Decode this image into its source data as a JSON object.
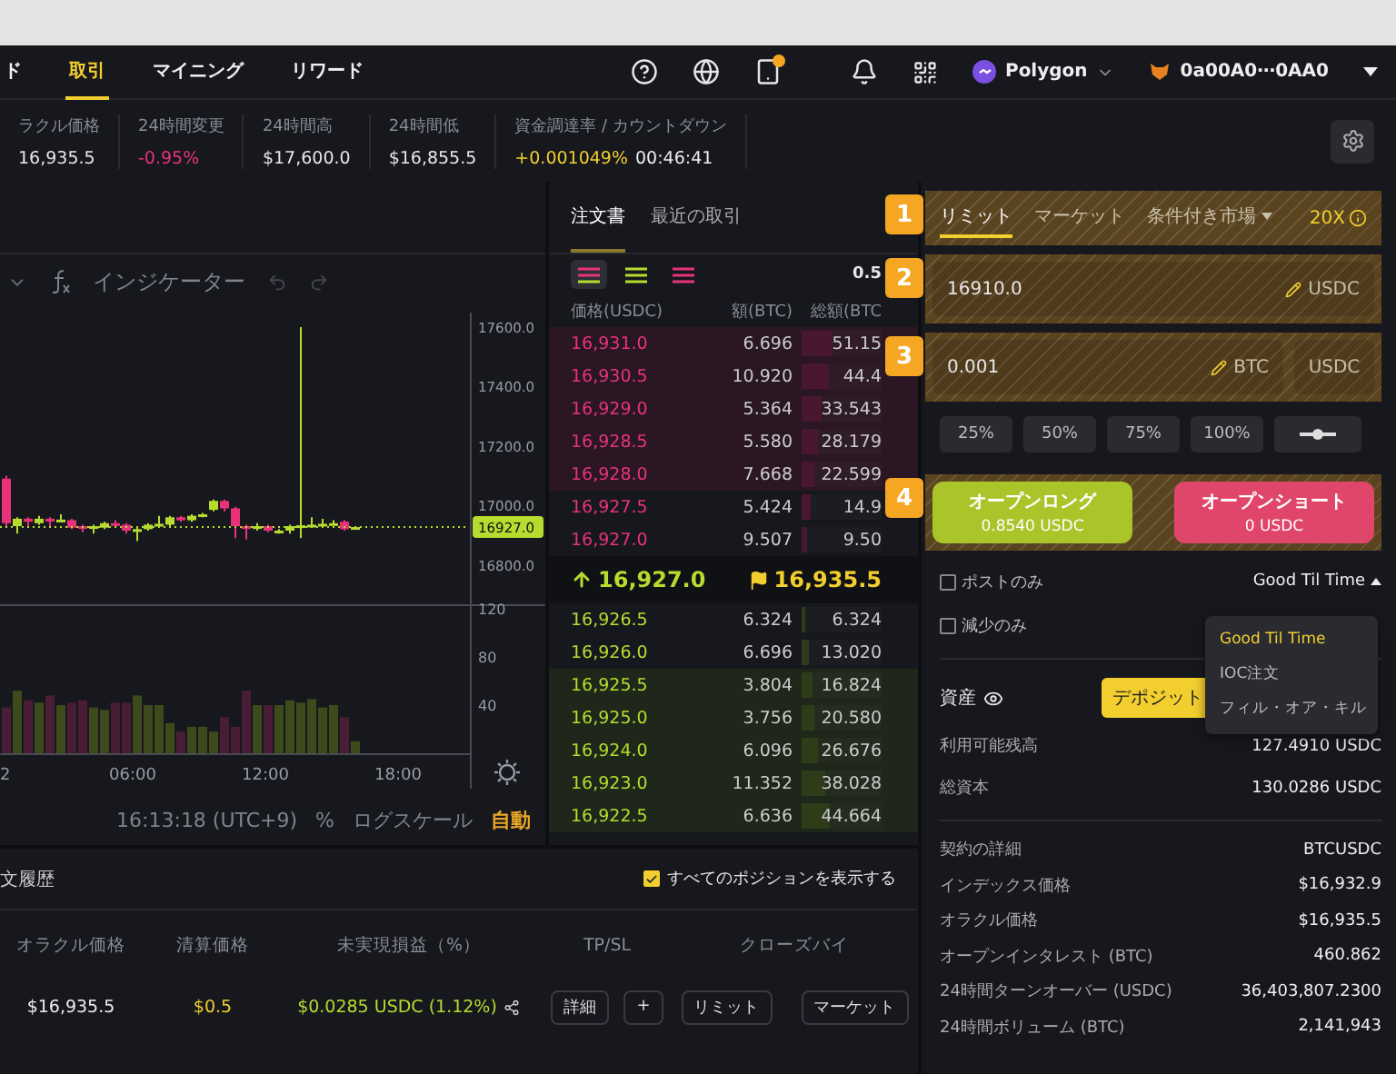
{
  "nav": {
    "tabs": [
      {
        "label": "ド",
        "selected": false
      },
      {
        "label": "取引",
        "selected": true
      },
      {
        "label": "マイニング",
        "selected": false
      },
      {
        "label": "リワード",
        "selected": false
      }
    ],
    "network": "Polygon",
    "wallet": "0a00A0⋯0AA0"
  },
  "stats": [
    {
      "label": "ラクル価格",
      "value": "16,935.5",
      "color": "#e6e6e6"
    },
    {
      "label": "24時間変更",
      "value": "-0.95%",
      "color": "#e8337a"
    },
    {
      "label": "24時間高",
      "value": "$17,600.0",
      "color": "#e6e6e6"
    },
    {
      "label": "24時間低",
      "value": "$16,855.5",
      "color": "#e6e6e6"
    },
    {
      "label": "資金調達率 / カウントダウン",
      "value": "+0.001049%",
      "extra": "00:46:41",
      "color": "#f2cf2e"
    }
  ],
  "chart": {
    "toolbar": "インジケーター",
    "price_ticks": [
      "17600.0",
      "17400.0",
      "17200.0",
      "17000.0",
      "16800.0"
    ],
    "current_price": "16927.0",
    "volume_ticks": [
      "120",
      "80",
      "40"
    ],
    "time_ticks": [
      "2",
      "06:00",
      "12:00",
      "18:00"
    ],
    "clock": "16:13:18 (UTC+9)",
    "percent": "%",
    "log": "ログスケール",
    "auto": "自動"
  },
  "orderbook": {
    "tabs": [
      {
        "label": "注文書",
        "selected": true
      },
      {
        "label": "最近の取引",
        "selected": false
      }
    ],
    "views": [
      {
        "kind": "both",
        "selected": true
      },
      {
        "kind": "bids",
        "selected": false
      },
      {
        "kind": "asks",
        "selected": false
      }
    ],
    "precision": "0.5",
    "columns": [
      "価格(USDC)",
      "額(BTC)",
      "総額(BTC"
    ],
    "asks": [
      {
        "price": "16,931.0",
        "amount": "6.696",
        "total": "51.15",
        "level": 0.38,
        "highlight": true
      },
      {
        "price": "16,930.5",
        "amount": "10.920",
        "total": "44.4",
        "level": 0.33,
        "highlight": true
      },
      {
        "price": "16,929.0",
        "amount": "5.364",
        "total": "33.543",
        "level": 0.26,
        "highlight": true
      },
      {
        "price": "16,928.5",
        "amount": "5.580",
        "total": "28.179",
        "level": 0.21,
        "highlight": true
      },
      {
        "price": "16,928.0",
        "amount": "7.668",
        "total": "22.599",
        "level": 0.17,
        "highlight": true
      },
      {
        "price": "16,927.5",
        "amount": "5.424",
        "total": "14.9",
        "level": 0.11,
        "highlight": false
      },
      {
        "price": "16,927.0",
        "amount": "9.507",
        "total": "9.50",
        "level": 0.07,
        "highlight": false
      }
    ],
    "last": "16,927.0",
    "mark": "16,935.5",
    "bids": [
      {
        "price": "16,926.5",
        "amount": "6.324",
        "total": "6.324",
        "level": 0.05,
        "highlight": false
      },
      {
        "price": "16,926.0",
        "amount": "6.696",
        "total": "13.020",
        "level": 0.1,
        "highlight": false
      },
      {
        "price": "16,925.5",
        "amount": "3.804",
        "total": "16.824",
        "level": 0.13,
        "highlight": true
      },
      {
        "price": "16,925.0",
        "amount": "3.756",
        "total": "20.580",
        "level": 0.16,
        "highlight": true
      },
      {
        "price": "16,924.0",
        "amount": "6.096",
        "total": "26.676",
        "level": 0.21,
        "highlight": true
      },
      {
        "price": "16,923.0",
        "amount": "11.352",
        "total": "38.028",
        "level": 0.3,
        "highlight": true
      },
      {
        "price": "16,922.5",
        "amount": "6.636",
        "total": "44.664",
        "level": 0.35,
        "highlight": true
      }
    ]
  },
  "order_form": {
    "tabs": [
      {
        "label": "リミット",
        "selected": true,
        "kind": "plain"
      },
      {
        "label": "マーケット",
        "selected": false,
        "kind": "plain"
      },
      {
        "label": "条件付き市場",
        "selected": false,
        "kind": "dropdown"
      }
    ],
    "leverage": "20X",
    "price": {
      "value": "16910.0",
      "unit": "USDC"
    },
    "size": {
      "value": "0.001",
      "unit": "BTC",
      "alt_unit": "USDC"
    },
    "percents": [
      "25%",
      "50%",
      "75%",
      "100%"
    ],
    "long": {
      "label": "オープンロング",
      "sub": "0.8540 USDC"
    },
    "short": {
      "label": "オープンショート",
      "sub": "0 USDC"
    },
    "options": [
      {
        "label": "ポストのみ",
        "checked": false
      },
      {
        "label": "減少のみ",
        "checked": false
      }
    ],
    "time_in_force": "Good Til Time",
    "menu": [
      {
        "label": "Good Til Time",
        "selected": true
      },
      {
        "label": "IOC注文",
        "selected": false
      },
      {
        "label": "フィル・オア・キル",
        "selected": false
      }
    ]
  },
  "badges": [
    "1",
    "2",
    "3",
    "4"
  ],
  "assets": {
    "title": "資産",
    "deposit": "デポジット",
    "balances": [
      {
        "label": "利用可能残高",
        "value": "127.4910 USDC"
      },
      {
        "label": "総資本",
        "value": "130.0286 USDC"
      }
    ],
    "details": [
      {
        "label": "契約の詳細",
        "value": "BTCUSDC"
      },
      {
        "label": "インデックス価格",
        "value": "$16,932.9"
      },
      {
        "label": "オラクル価格",
        "value": "$16,935.5"
      },
      {
        "label": "オープンインタレスト (BTC)",
        "value": "460.862"
      },
      {
        "label": "24時間ターンオーバー (USDC)",
        "value": "36,403,807.2300"
      },
      {
        "label": "24時間ボリューム (BTC)",
        "value": "2,141,943"
      }
    ]
  },
  "positions": {
    "title": "文履歴",
    "show_all": {
      "label": "すべてのポジションを表示する",
      "checked": true
    },
    "columns": [
      "オラクル価格",
      "清算価格",
      "未実現損益（%）",
      "TP/SL",
      "クローズバイ"
    ],
    "row": {
      "oracle": "$16,935.5",
      "liquidation": "$0.5",
      "pnl": "$0.0285 USDC (1.12%)",
      "tpsl_buttons": [
        "詳細",
        "+"
      ],
      "close_buttons": [
        "リミット",
        "マーケット"
      ]
    }
  }
}
